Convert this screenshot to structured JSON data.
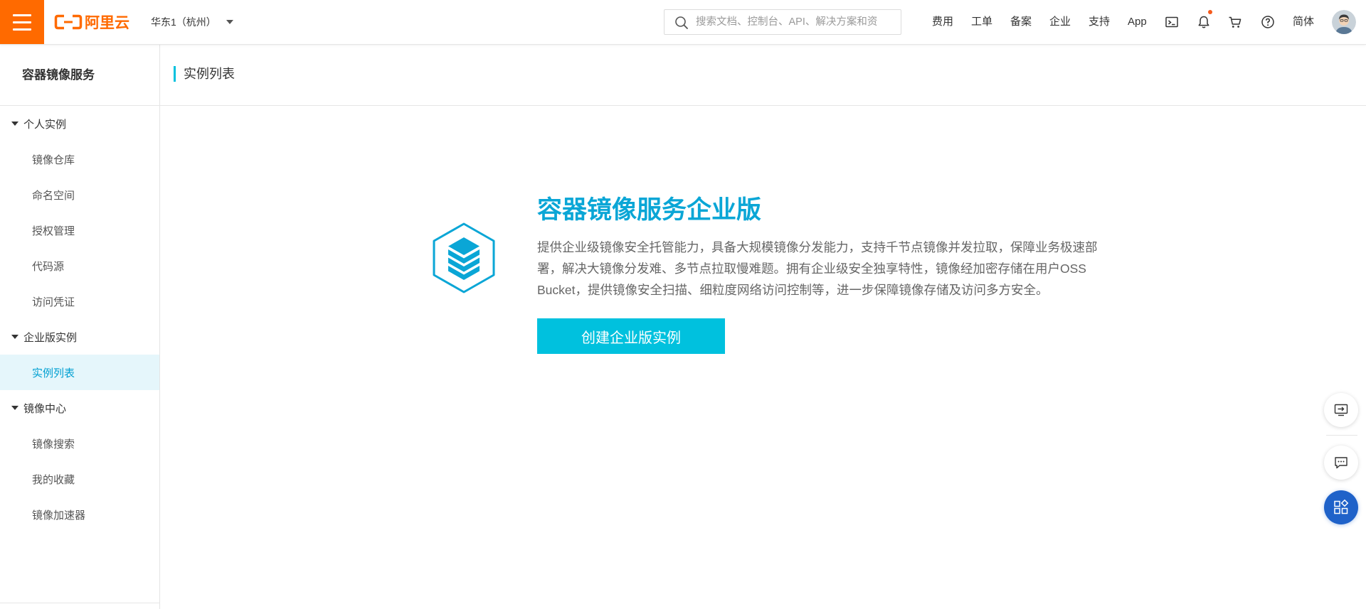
{
  "topbar": {
    "logo_text": "阿里云",
    "region": "华东1（杭州）",
    "search_placeholder": "搜索文档、控制台、API、解决方案和资",
    "nav": [
      {
        "label": "费用"
      },
      {
        "label": "工单"
      },
      {
        "label": "备案"
      },
      {
        "label": "企业"
      },
      {
        "label": "支持"
      },
      {
        "label": "App"
      }
    ],
    "language": "简体",
    "has_unread_notifications": true,
    "icons": {
      "menu": "hamburger-icon",
      "logo": "aliyun-logo-icon",
      "region_caret": "caret-down-icon",
      "search": "search-icon",
      "terminal": "terminal-icon",
      "notifications": "bell-icon",
      "cart": "cart-icon",
      "help": "help-circle-icon",
      "avatar": "avatar"
    }
  },
  "sidebar": {
    "title": "容器镜像服务",
    "groups": [
      {
        "label": "个人实例",
        "expanded": true,
        "items": [
          {
            "label": "镜像仓库"
          },
          {
            "label": "命名空间"
          },
          {
            "label": "授权管理"
          },
          {
            "label": "代码源"
          },
          {
            "label": "访问凭证"
          }
        ]
      },
      {
        "label": "企业版实例",
        "expanded": true,
        "items": [
          {
            "label": "实例列表",
            "active": true
          }
        ]
      },
      {
        "label": "镜像中心",
        "expanded": true,
        "items": [
          {
            "label": "镜像搜索"
          },
          {
            "label": "我的收藏"
          },
          {
            "label": "镜像加速器"
          }
        ]
      }
    ]
  },
  "main": {
    "page_title": "实例列表",
    "hero": {
      "icon": "container-registry-icon",
      "title": "容器镜像服务企业版",
      "description_lines": [
        "提供企业级镜像安全托管能力，具备大规模镜像分发能力，支持千节点镜像并发拉取，保障业务极速部",
        "署，解决大镜像分发难、多节点拉取慢难题。拥有企业级安全独享特性，镜像经加密存储在用户OSS",
        "Bucket，提供镜像安全扫描、细粒度网络访问控制等，进一步保障镜像存储及访问多方安全。"
      ],
      "button_label": "创建企业版实例"
    }
  },
  "floating_tools": [
    {
      "icon": "monitor-arrow-icon"
    },
    {
      "icon": "chat-bubble-icon"
    },
    {
      "icon": "apps-grid-icon",
      "primary": true
    }
  ],
  "colors": {
    "brand": "#ff6a00",
    "accent": "#00c1de",
    "title": "#0aa6d6",
    "active_bg": "#e5f6fb",
    "active_text": "#00a0d2",
    "primary_float": "#1f62c9",
    "notification_dot": "#f55a1c"
  }
}
